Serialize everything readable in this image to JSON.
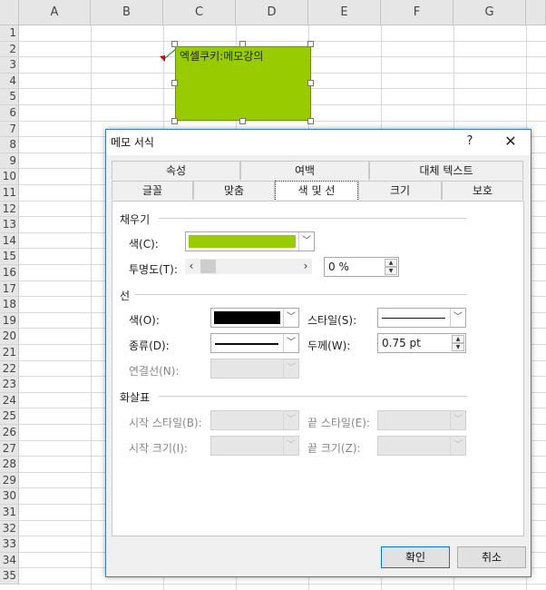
{
  "sheet": {
    "columns": [
      "A",
      "B",
      "C",
      "D",
      "E",
      "F",
      "G"
    ],
    "rows": [
      "1",
      "2",
      "3",
      "4",
      "5",
      "6",
      "7",
      "8",
      "9",
      "10",
      "11",
      "12",
      "13",
      "14",
      "15",
      "16",
      "17",
      "18",
      "19",
      "20",
      "21",
      "22",
      "23",
      "24",
      "25",
      "26",
      "27",
      "28",
      "29",
      "30",
      "31",
      "32",
      "33",
      "34",
      "35"
    ]
  },
  "comment": {
    "text": "엑셀쿠키:메모강의",
    "fill_color": "#99cc00"
  },
  "dialog": {
    "title": "메모 서식",
    "help": "?",
    "close": "✕",
    "tabs_top": [
      "속성",
      "여백",
      "대체 텍스트"
    ],
    "tabs_bottom": [
      "글꼴",
      "맞춤",
      "색 및 선",
      "크기",
      "보호"
    ],
    "active_tab": "색 및 선",
    "fill": {
      "title": "채우기",
      "color_label": "색(C):",
      "color_value": "#99cc00",
      "transparency_label": "투명도(T):",
      "transparency_value": "0 %",
      "transparency_level": 0
    },
    "line": {
      "title": "선",
      "color_label": "색(O):",
      "color_value": "#000000",
      "style_label": "스타일(S):",
      "dash_label": "종류(D):",
      "weight_label": "두께(W):",
      "weight_value": "0.75 pt",
      "connector_label": "연결선(N):"
    },
    "arrows": {
      "title": "화살표",
      "begin_style_label": "시작 스타일(B):",
      "end_style_label": "끝 스타일(E):",
      "begin_size_label": "시작 크기(I):",
      "end_size_label": "끝 크기(Z):"
    },
    "ok": "확인",
    "cancel": "취소"
  }
}
